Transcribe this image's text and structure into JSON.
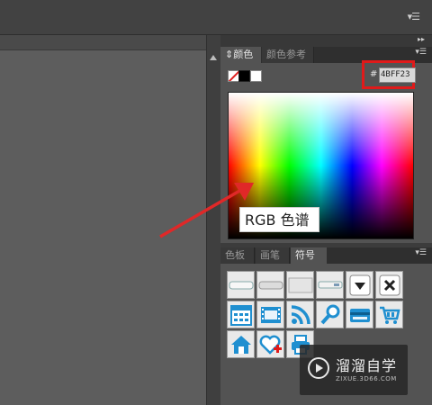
{
  "topbar": {
    "menu_icon": "panel-menu-icon"
  },
  "color_panel": {
    "tabs": [
      {
        "label": "颜色",
        "active": true
      },
      {
        "label": "颜色参考",
        "active": false
      }
    ],
    "hex_prefix": "#",
    "hex_value": "4BFF23",
    "callout": "RGB 色谱"
  },
  "swatch_panel": {
    "tabs": [
      {
        "label": "色板",
        "active": false
      },
      {
        "label": "画笔",
        "active": false
      },
      {
        "label": "符号",
        "active": true
      }
    ],
    "symbols": [
      "button-bar-1-icon",
      "button-bar-2-icon",
      "button-bar-3-icon",
      "button-bar-4-icon",
      "dropdown-arrow-icon",
      "close-x-icon",
      "calendar-icon",
      "film-icon",
      "rss-icon",
      "magnifier-icon",
      "credit-card-icon",
      "cart-icon",
      "home-icon",
      "heart-add-icon",
      "printer-icon"
    ]
  },
  "watermark": {
    "title": "溜溜自学",
    "subtitle": "ZIXUE.3D66.COM"
  },
  "colors": {
    "highlight": "#e01a1a",
    "arrow": "#e02828",
    "symbol_blue": "#1f8fd0"
  }
}
